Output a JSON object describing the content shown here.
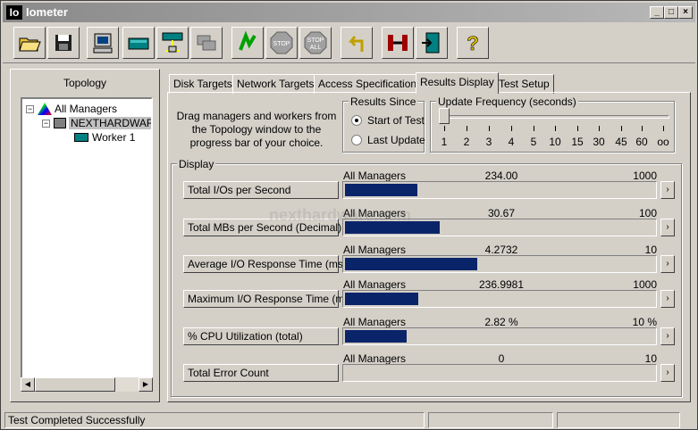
{
  "window": {
    "title": "Iometer",
    "icon_text": "Io"
  },
  "toolbar": {
    "buttons": [
      {
        "name": "open-icon"
      },
      {
        "name": "save-icon"
      },
      {
        "name": "display-icon"
      },
      {
        "name": "disk-icon"
      },
      {
        "name": "network-icon"
      },
      {
        "name": "copy-icon"
      },
      {
        "name": "start-icon"
      },
      {
        "name": "stop-icon",
        "label": "STOP"
      },
      {
        "name": "stop-all-icon",
        "label": "STOP\nALL"
      },
      {
        "name": "reset-icon"
      },
      {
        "name": "connect-icon"
      },
      {
        "name": "exit-icon"
      },
      {
        "name": "help-icon",
        "label": "?"
      }
    ]
  },
  "topology": {
    "header": "Topology",
    "items": [
      "All Managers",
      "NEXTHARDWAR",
      "Worker 1"
    ]
  },
  "tabs": [
    "Disk Targets",
    "Network Targets",
    "Access Specifications",
    "Results Display",
    "Test Setup"
  ],
  "active_tab": "Results Display",
  "instructions": "Drag managers and workers from the Topology window to the progress bar of your choice.",
  "results_since": {
    "label": "Results Since",
    "options": [
      "Start of Test",
      "Last Update"
    ],
    "selected": "Start of Test"
  },
  "update_frequency": {
    "label": "Update Frequency (seconds)",
    "ticks": [
      "1",
      "2",
      "3",
      "4",
      "5",
      "10",
      "15",
      "30",
      "45",
      "60",
      "oo"
    ],
    "value_index": 0
  },
  "display": {
    "label": "Display",
    "metrics": [
      {
        "button": "Total I/Os per Second",
        "source": "All Managers",
        "value": "234.00",
        "max": "1000",
        "fraction": 0.234
      },
      {
        "button": "Total MBs per Second (Decimal)",
        "source": "All Managers",
        "value": "30.67",
        "max": "100",
        "fraction": 0.3067
      },
      {
        "button": "Average I/O Response Time (ms)",
        "source": "All Managers",
        "value": "4.2732",
        "max": "10",
        "fraction": 0.42732
      },
      {
        "button": "Maximum I/O Response Time (ms)",
        "source": "All Managers",
        "value": "236.9981",
        "max": "1000",
        "fraction": 0.237
      },
      {
        "button": "% CPU Utilization (total)",
        "source": "All Managers",
        "value": "2.82 %",
        "max": "10 %",
        "fraction": 0.2
      },
      {
        "button": "Total Error Count",
        "source": "All Managers",
        "value": "0",
        "max": "10",
        "fraction": 0
      }
    ]
  },
  "status": {
    "message": "Test Completed Successfully"
  },
  "watermark": "nexthardware.com"
}
